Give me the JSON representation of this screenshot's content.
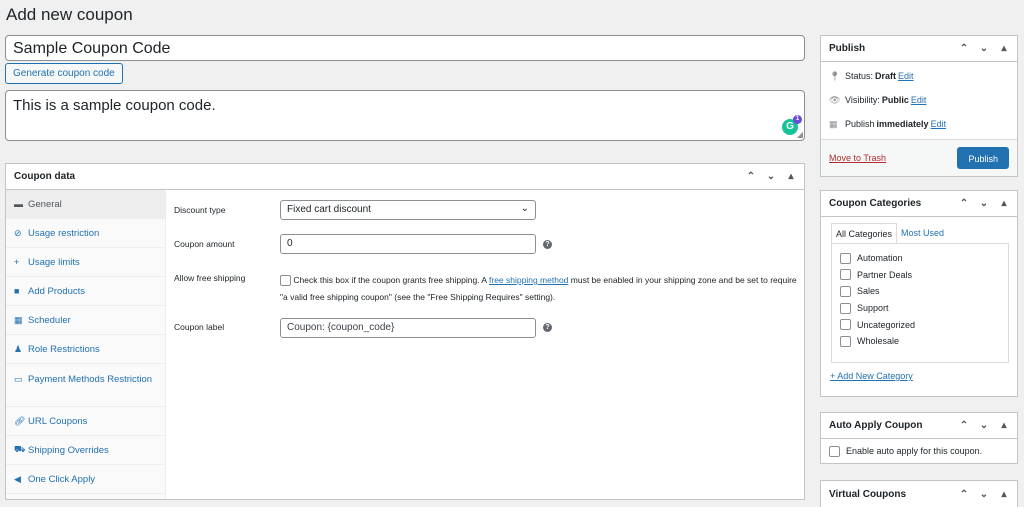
{
  "page": {
    "title": "Add new coupon"
  },
  "coupon": {
    "code_value": "Sample Coupon Code",
    "generate_label": "Generate coupon code",
    "description": "This is a sample coupon code."
  },
  "grammarly": {
    "letter": "G",
    "count": "1"
  },
  "coupon_data": {
    "title": "Coupon data",
    "tabs": [
      {
        "label": "General",
        "icon": "ticket-icon"
      },
      {
        "label": "Usage restriction",
        "icon": "block-icon"
      },
      {
        "label": "Usage limits",
        "icon": "plus-move-icon"
      },
      {
        "label": "Add Products",
        "icon": "bag-icon"
      },
      {
        "label": "Scheduler",
        "icon": "calendar-icon"
      },
      {
        "label": "Role Restrictions",
        "icon": "user-icon"
      },
      {
        "label": "Payment Methods Restriction",
        "icon": "card-icon"
      },
      {
        "label": "URL Coupons",
        "icon": "link-icon"
      },
      {
        "label": "Shipping Overrides",
        "icon": "truck-icon"
      },
      {
        "label": "One Click Apply",
        "icon": "megaphone-icon"
      }
    ],
    "fields": {
      "discount_type_label": "Discount type",
      "discount_type_value": "Fixed cart discount",
      "amount_label": "Coupon amount",
      "amount_value": "0",
      "free_shipping_label": "Allow free shipping",
      "free_shipping_text_1": "Check this box if the coupon grants free shipping. A",
      "free_shipping_link": "free shipping method",
      "free_shipping_text_2": "must be enabled in your shipping zone and be set to require \"a valid free shipping coupon\" (see the \"Free Shipping Requires\" setting).",
      "label_label": "Coupon label",
      "label_value": "Coupon: {coupon_code}"
    }
  },
  "publish": {
    "title": "Publish",
    "status_label": "Status:",
    "status_value": "Draft",
    "visibility_label": "Visibility:",
    "visibility_value": "Public",
    "publish_label": "Publish",
    "publish_value": "immediately",
    "edit": "Edit",
    "trash": "Move to Trash",
    "publish_button": "Publish"
  },
  "categories": {
    "title": "Coupon Categories",
    "tab_all": "All Categories",
    "tab_used": "Most Used",
    "items": [
      "Automation",
      "Partner Deals",
      "Sales",
      "Support",
      "Uncategorized",
      "Wholesale"
    ],
    "add_new": "+ Add New Category"
  },
  "auto_apply": {
    "title": "Auto Apply Coupon",
    "checkbox_label": "Enable auto apply for this coupon."
  },
  "virtual": {
    "title": "Virtual Coupons"
  },
  "colors": {
    "accent": "#2271b1",
    "trash": "#b32d2e",
    "grammarly": "#15c39a"
  }
}
